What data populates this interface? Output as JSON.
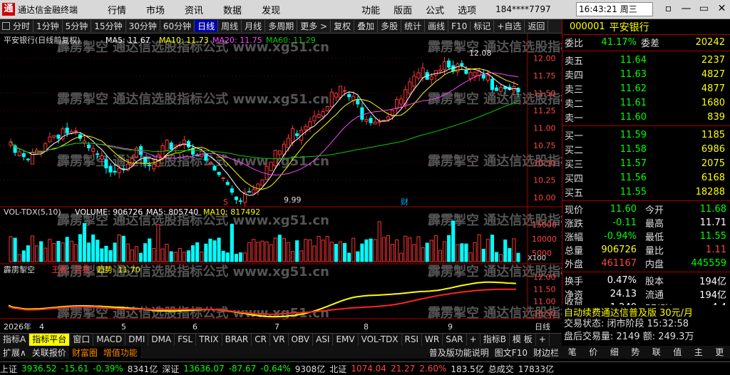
{
  "menubar": {
    "logo": "通",
    "app_title": "通达信金融终端",
    "menus": [
      "行情",
      "市场",
      "资讯",
      "数据",
      "发现"
    ],
    "menus2": [
      "功能",
      "版面",
      "公式",
      "选项"
    ],
    "user": "184****7797",
    "clock": "16:43:21 周三",
    "win_buttons": [
      "▫",
      "—",
      "▭",
      "✕"
    ]
  },
  "toolbar": {
    "items": [
      "分时",
      "1分钟",
      "5分钟",
      "15分钟",
      "30分钟",
      "60分钟",
      "日线",
      "周线",
      "月线",
      "多周期",
      "更多 >",
      "复权",
      "叠加",
      "多股",
      "统计",
      "画线",
      "F10",
      "标记",
      "+自选",
      "返回"
    ],
    "active": "日线"
  },
  "chart": {
    "title_stock": "平安银行(日线前复权)",
    "ma_labels": [
      {
        "text": "MA5: 11.67",
        "color": "#ffffff"
      },
      {
        "text": "MA10: 11.73",
        "color": "#ffff00"
      },
      {
        "text": "MA20: 11.75",
        "color": "#ff44ff"
      },
      {
        "text": "MA60: 11.29",
        "color": "#00cc00"
      }
    ],
    "high_label": "12.08",
    "low_label": "9.99",
    "markers": [
      {
        "text": "S",
        "color": "#ff3333"
      },
      {
        "text": "财",
        "color": "#00aaff"
      }
    ],
    "price_ticks": [
      "12.00",
      "11.75",
      "11.50",
      "11.25",
      "11.00",
      "10.75",
      "10.50",
      "10.25",
      "10.00"
    ],
    "vol_title": "VOL-TDX(5,10)",
    "vol_values": [
      {
        "text": "VOLUME: 906726",
        "color": "#ffffff"
      },
      {
        "text": "MA5: 805740",
        "color": "#ffffff"
      },
      {
        "text": "MA10: 817492",
        "color": "#ffff00"
      }
    ],
    "vol_ticks": [
      "15000",
      "10000",
      "5000"
    ],
    "vol_unit": "X100",
    "ind_title": "霹雳掣空",
    "ind_values": [
      {
        "text": "王者:",
        "color": "#ff3333"
      },
      {
        "text": "月亮:",
        "color": "#ff3333"
      },
      {
        "text": "趋势: 11.70",
        "color": "#ffff00"
      }
    ],
    "ind_ticks": [
      "12.00",
      "11.50",
      "11.00",
      "10.50"
    ],
    "x_labels": [
      "2026年",
      "4",
      "5",
      "6",
      "7",
      "8",
      "9"
    ],
    "period": "日线"
  },
  "quote": {
    "code": "000001",
    "name": "平安银行",
    "ratio_label": "委比",
    "ratio_value": "41.17%",
    "diff_label": "委差",
    "diff_value": "20242",
    "asks": [
      {
        "label": "卖五",
        "price": "11.64",
        "vol": "2237"
      },
      {
        "label": "卖四",
        "price": "11.63",
        "vol": "4827"
      },
      {
        "label": "卖三",
        "price": "11.62",
        "vol": "4877"
      },
      {
        "label": "卖二",
        "price": "11.61",
        "vol": "1680"
      },
      {
        "label": "卖一",
        "price": "11.60",
        "vol": "839"
      }
    ],
    "bids": [
      {
        "label": "买一",
        "price": "11.59",
        "vol": "1185"
      },
      {
        "label": "买二",
        "price": "11.58",
        "vol": "6986"
      },
      {
        "label": "买三",
        "price": "11.57",
        "vol": "2075"
      },
      {
        "label": "买四",
        "price": "11.56",
        "vol": "6168"
      },
      {
        "label": "买五",
        "price": "11.55",
        "vol": "18288"
      }
    ],
    "stats": [
      {
        "l1": "现价",
        "v1": "11.60",
        "c1": "green",
        "l2": "今开",
        "v2": "11.68",
        "c2": "green"
      },
      {
        "l1": "涨跌",
        "v1": "-0.11",
        "c1": "green",
        "l2": "最高",
        "v2": "11.71",
        "c2": "white"
      },
      {
        "l1": "涨幅",
        "v1": "-0.94%",
        "c1": "green",
        "l2": "最低",
        "v2": "11.55",
        "c2": "green"
      },
      {
        "l1": "总量",
        "v1": "906726",
        "c1": "yellow",
        "l2": "量比",
        "v2": "1.11",
        "c2": "red"
      },
      {
        "l1": "外盘",
        "v1": "461167",
        "c1": "red",
        "l2": "内盘",
        "v2": "445559",
        "c2": "green"
      }
    ],
    "stats2": [
      {
        "l1": "换手",
        "v1": "0.47%",
        "c1": "white",
        "l2": "股本",
        "v2": "194亿",
        "c2": "white"
      },
      {
        "l1": "净资",
        "v1": "24.13",
        "c1": "white",
        "l2": "流通",
        "v2": "194亿",
        "c2": "white"
      },
      {
        "l1": "收益(三)",
        "v1": "1.240",
        "c1": "white",
        "l2": "PE(动)",
        "v2": "4.4",
        "c2": "white"
      }
    ],
    "ad": "自动续费通达信普及版 30元/月",
    "status_label": "交易状态: 闭市阶段 15:32:58",
    "after_volume": "盘后交易量: 2149  额: 249.3万",
    "bottom_items": [
      "笔",
      "价",
      "细",
      "势",
      "联",
      "值",
      "主",
      "更"
    ]
  },
  "tabs": {
    "items": [
      "指标A",
      "指标平台",
      "窗口",
      "MACD",
      "DMI",
      "DMA",
      "FSL",
      "TRIX",
      "BRAR",
      "CR",
      "VR",
      "OBV",
      "ASI",
      "EMV",
      "VOL-TDX",
      "RSI",
      "WR",
      "SAR",
      "+",
      "指标B",
      "模 板",
      "+"
    ],
    "active": "指标平台",
    "row2": [
      "扩展∧",
      "关联报价",
      "财富圈",
      "增值功能"
    ],
    "row2_right": [
      "普及版功能说明",
      "图文F10",
      "财边栏"
    ]
  },
  "ticker": [
    {
      "text": "上证",
      "color": "#ddd"
    },
    {
      "text": "3936.52",
      "color": "#0f0"
    },
    {
      "text": "-15.61",
      "color": "#0f0"
    },
    {
      "text": "-0.39%",
      "color": "#0f0"
    },
    {
      "text": "8341亿",
      "color": "#ddd"
    },
    {
      "text": "深证",
      "color": "#ddd"
    },
    {
      "text": "13636.07",
      "color": "#0f0"
    },
    {
      "text": "-87.67",
      "color": "#0f0"
    },
    {
      "text": "-0.64%",
      "color": "#0f0"
    },
    {
      "text": "9308亿",
      "color": "#ddd"
    },
    {
      "text": "北证",
      "color": "#ddd"
    },
    {
      "text": "1074.04",
      "color": "#f44"
    },
    {
      "text": "21.27",
      "color": "#f44"
    },
    {
      "text": "2.60%",
      "color": "#f44"
    },
    {
      "text": "183.5亿",
      "color": "#ddd"
    },
    {
      "text": "总成交",
      "color": "#ddd"
    },
    {
      "text": "17833亿",
      "color": "#ddd"
    }
  ],
  "watermark": "霹雳掣空 通达信选股指标公式 www.xg51.cn"
}
